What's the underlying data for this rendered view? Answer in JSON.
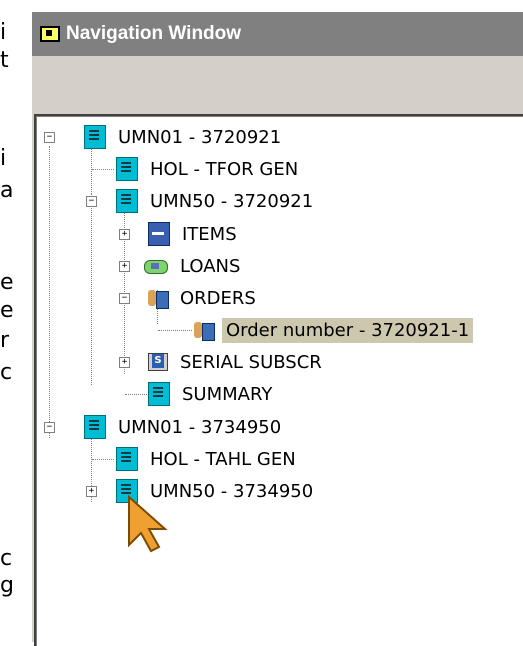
{
  "window": {
    "title": "Navigation Window"
  },
  "left_strip": [
    "i",
    "t",
    "i",
    "a",
    "e",
    "e",
    "r",
    "c",
    "c",
    "g"
  ],
  "tree": [
    {
      "label": "UMN01 - 3720921",
      "icon": "document-icon",
      "toggle": "−"
    },
    {
      "label": "HOL - TFOR  GEN",
      "icon": "document-icon"
    },
    {
      "label": "UMN50 - 3720921",
      "icon": "document-icon",
      "toggle": "−"
    },
    {
      "label": "ITEMS",
      "icon": "items-icon",
      "toggle": "+"
    },
    {
      "label": "LOANS",
      "icon": "loans-icon",
      "toggle": "+"
    },
    {
      "label": "ORDERS",
      "icon": "orders-icon",
      "toggle": "−"
    },
    {
      "label": "Order number - 3720921-1",
      "icon": "order-record-icon",
      "selected": true
    },
    {
      "label": "SERIAL SUBSCR",
      "icon": "serial-icon",
      "toggle": "+"
    },
    {
      "label": "SUMMARY",
      "icon": "document-icon"
    },
    {
      "label": "UMN01 - 3734950",
      "icon": "document-icon",
      "toggle": "−"
    },
    {
      "label": "HOL - TAHL  GEN",
      "icon": "document-icon"
    },
    {
      "label": "UMN50 - 3734950",
      "icon": "document-icon",
      "toggle": "+"
    }
  ],
  "colors": {
    "titlebar": "#808080",
    "panel": "#d4d0c8",
    "selection": "#cdc8ad",
    "cursor": "#f0a030"
  }
}
